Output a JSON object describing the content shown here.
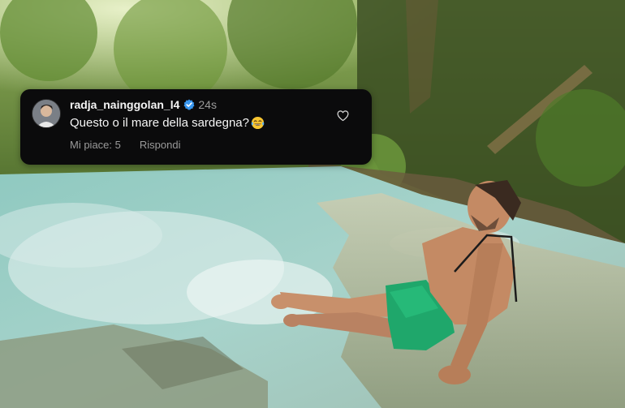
{
  "comment": {
    "username": "radja_nainggolan_l4",
    "time": "24s",
    "text": "Questo o il mare della sardegna?",
    "emoji": "laughing-tears-emoji",
    "likes_label": "Mi piace: 5",
    "reply_label": "Rispondi",
    "verified_icon": "verified-badge-icon",
    "like_icon": "heart-icon"
  },
  "colors": {
    "card_background": "#0b0b0c",
    "primary_text": "#f5f5f5",
    "secondary_text": "#9a9a9a",
    "verified_blue": "#3897f0"
  }
}
